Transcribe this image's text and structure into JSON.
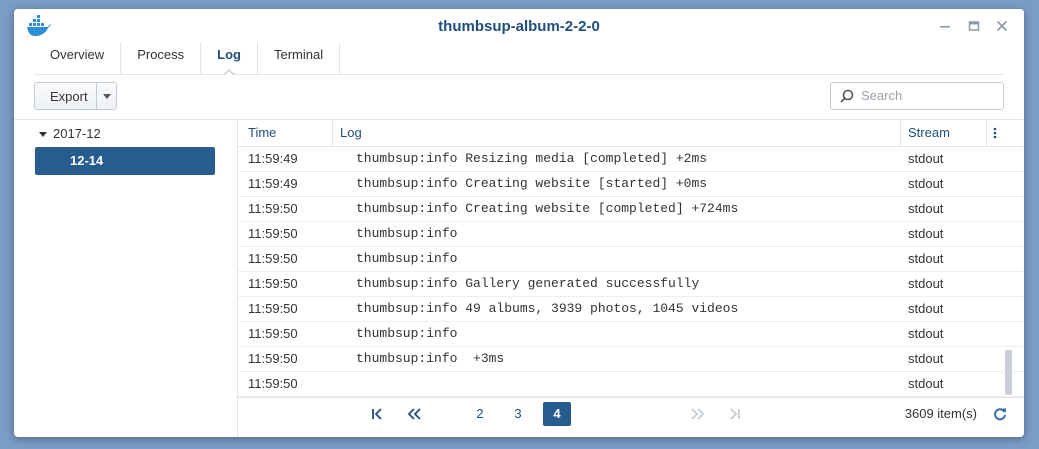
{
  "window": {
    "title": "thumbsup-album-2-2-0",
    "minimize_icon": "minimize-icon",
    "maximize_icon": "maximize-icon",
    "close_icon": "close-icon"
  },
  "tabs": [
    {
      "label": "Overview",
      "active": false
    },
    {
      "label": "Process",
      "active": false
    },
    {
      "label": "Log",
      "active": true
    },
    {
      "label": "Terminal",
      "active": false
    }
  ],
  "toolbar": {
    "export_label": "Export",
    "search_placeholder": "Search"
  },
  "sidebar": {
    "group_label": "2017-12",
    "selected_item": "12-14"
  },
  "grid": {
    "columns": [
      "Time",
      "Log",
      "Stream"
    ],
    "rows": [
      {
        "time": "11:59:49",
        "log": "thumbsup:info Resizing media [completed] +2ms",
        "stream": "stdout"
      },
      {
        "time": "11:59:49",
        "log": "thumbsup:info Creating website [started] +0ms",
        "stream": "stdout"
      },
      {
        "time": "11:59:50",
        "log": "thumbsup:info Creating website [completed] +724ms",
        "stream": "stdout"
      },
      {
        "time": "11:59:50",
        "log": "thumbsup:info",
        "stream": "stdout"
      },
      {
        "time": "11:59:50",
        "log": "thumbsup:info",
        "stream": "stdout"
      },
      {
        "time": "11:59:50",
        "log": "thumbsup:info Gallery generated successfully",
        "stream": "stdout"
      },
      {
        "time": "11:59:50",
        "log": "thumbsup:info 49 albums, 3939 photos, 1045 videos",
        "stream": "stdout"
      },
      {
        "time": "11:59:50",
        "log": "thumbsup:info",
        "stream": "stdout"
      },
      {
        "time": "11:59:50",
        "log": "thumbsup:info  +3ms",
        "stream": "stdout"
      },
      {
        "time": "11:59:50",
        "log": "",
        "stream": "stdout"
      }
    ]
  },
  "pager": {
    "pages": [
      "2",
      "3",
      "4"
    ],
    "current_page": "4",
    "total_items": "3609 item(s)"
  },
  "colors": {
    "accent": "#275d8e",
    "title": "#1f4e7d",
    "desktop": "#7a9cc6"
  }
}
